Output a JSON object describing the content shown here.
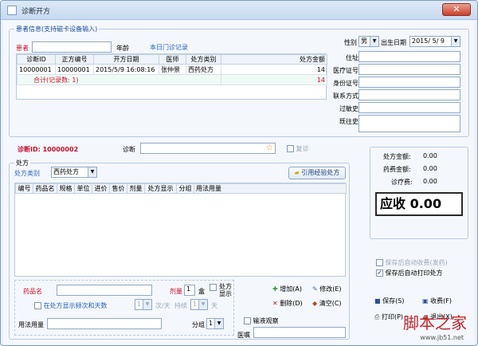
{
  "window": {
    "title": "诊断开方",
    "close_glyph": "✕"
  },
  "patient": {
    "group_label": "患者信息(支持磁卡设备输入)",
    "name_label": "患者",
    "age_label": "年龄",
    "history_link": "本日门诊记录",
    "sex_label": "性别",
    "sex_value": "男",
    "dob_label": "出生日期",
    "dob_value": "2015/ 5/ 9",
    "address_label": "住址",
    "insurance_label": "医疗证号",
    "idcard_label": "身份证号",
    "contact_label": "联系方式",
    "allergy_label": "过敏史",
    "history_label": "既往史"
  },
  "visit_table": {
    "headers": [
      "诊断ID",
      "正方编号",
      "开方日期",
      "医师",
      "处方类别",
      "处方金额"
    ],
    "rows": [
      [
        "10000001",
        "10000001",
        "2015/5/9 16:08:16",
        "张仲景",
        "西药处方",
        "14"
      ]
    ],
    "footer_label": "合计(记录数: 1)",
    "footer_total": "14"
  },
  "diagnosis": {
    "id_label": "诊断ID: 10000002",
    "diag_label": "诊断",
    "recheck_label": "复诊",
    "star_icon": "☆"
  },
  "prescription": {
    "group_label": "处方",
    "type_label": "处方类别",
    "type_value": "西药处方",
    "quote_button": "引用经验处方",
    "headers": [
      "编号",
      "药品名",
      "规格",
      "单位",
      "进价",
      "售价",
      "剂量",
      "处方显示",
      "分组",
      "用法用量"
    ]
  },
  "drug_entry": {
    "name_label": "药品名",
    "dose_label": "剂量",
    "dose_value": "1",
    "dose_unit": "盒",
    "show_label": "处方显示",
    "freq_label": "在处方显示频次和天数",
    "freq_value": "1",
    "freq_unit": "次/天",
    "duration_label": "持续",
    "duration_value": "1",
    "duration_unit": "天",
    "usage_label": "用法用量",
    "group_label": "分组",
    "group_value": "1"
  },
  "actions": {
    "add": "增加(A)",
    "edit": "修改(E)",
    "delete": "删除(D)",
    "clear": "清空(C)",
    "infusion_label": "输液观察",
    "advice_label": "医嘱"
  },
  "summary": {
    "rx_amount_label": "处方金额:",
    "rx_amount": "0.00",
    "drug_amount_label": "药费金额:",
    "drug_amount": "0.00",
    "fee_label": "诊疗费:",
    "fee": "0.00",
    "receivable_label": "应收",
    "receivable": "0.00",
    "auto_charge_label": "保存后自动收费(发药)",
    "auto_print_label": "保存后自动打印处方",
    "save": "保存(S)",
    "charge": "收费(F)",
    "print": "打印(P)",
    "exit": "退出(X)"
  },
  "watermark": {
    "logo": "脚本之家",
    "url": "www.jb51.net"
  }
}
